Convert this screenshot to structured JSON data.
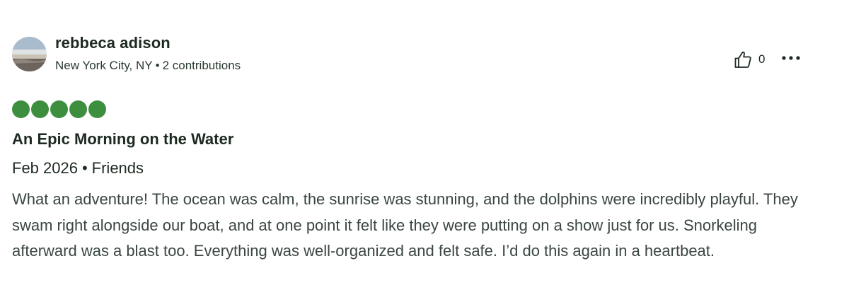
{
  "reviewer": {
    "name": "rebbeca adison",
    "location": "New York City, NY",
    "separator": "•",
    "contributions": "2 contributions"
  },
  "actions": {
    "helpful_icon": "thumbs-up-icon",
    "helpful_count": "0",
    "more_icon": "more-options-icon"
  },
  "review": {
    "rating": 5,
    "rating_max": 5,
    "rating_color": "#3e8e3f",
    "title": "An Epic Morning on the Water",
    "visit_date": "Feb 2026",
    "visit_separator": "•",
    "trip_type": "Friends",
    "body": "What an adventure! The ocean was calm, the sunrise was stunning, and the dolphins were incredibly playful. They swam right alongside our boat, and at one point it felt like they were putting on a show just for us. Snorkeling afterward was a blast too. Everything was well-organized and felt safe. I’d do this again in a heartbeat."
  }
}
